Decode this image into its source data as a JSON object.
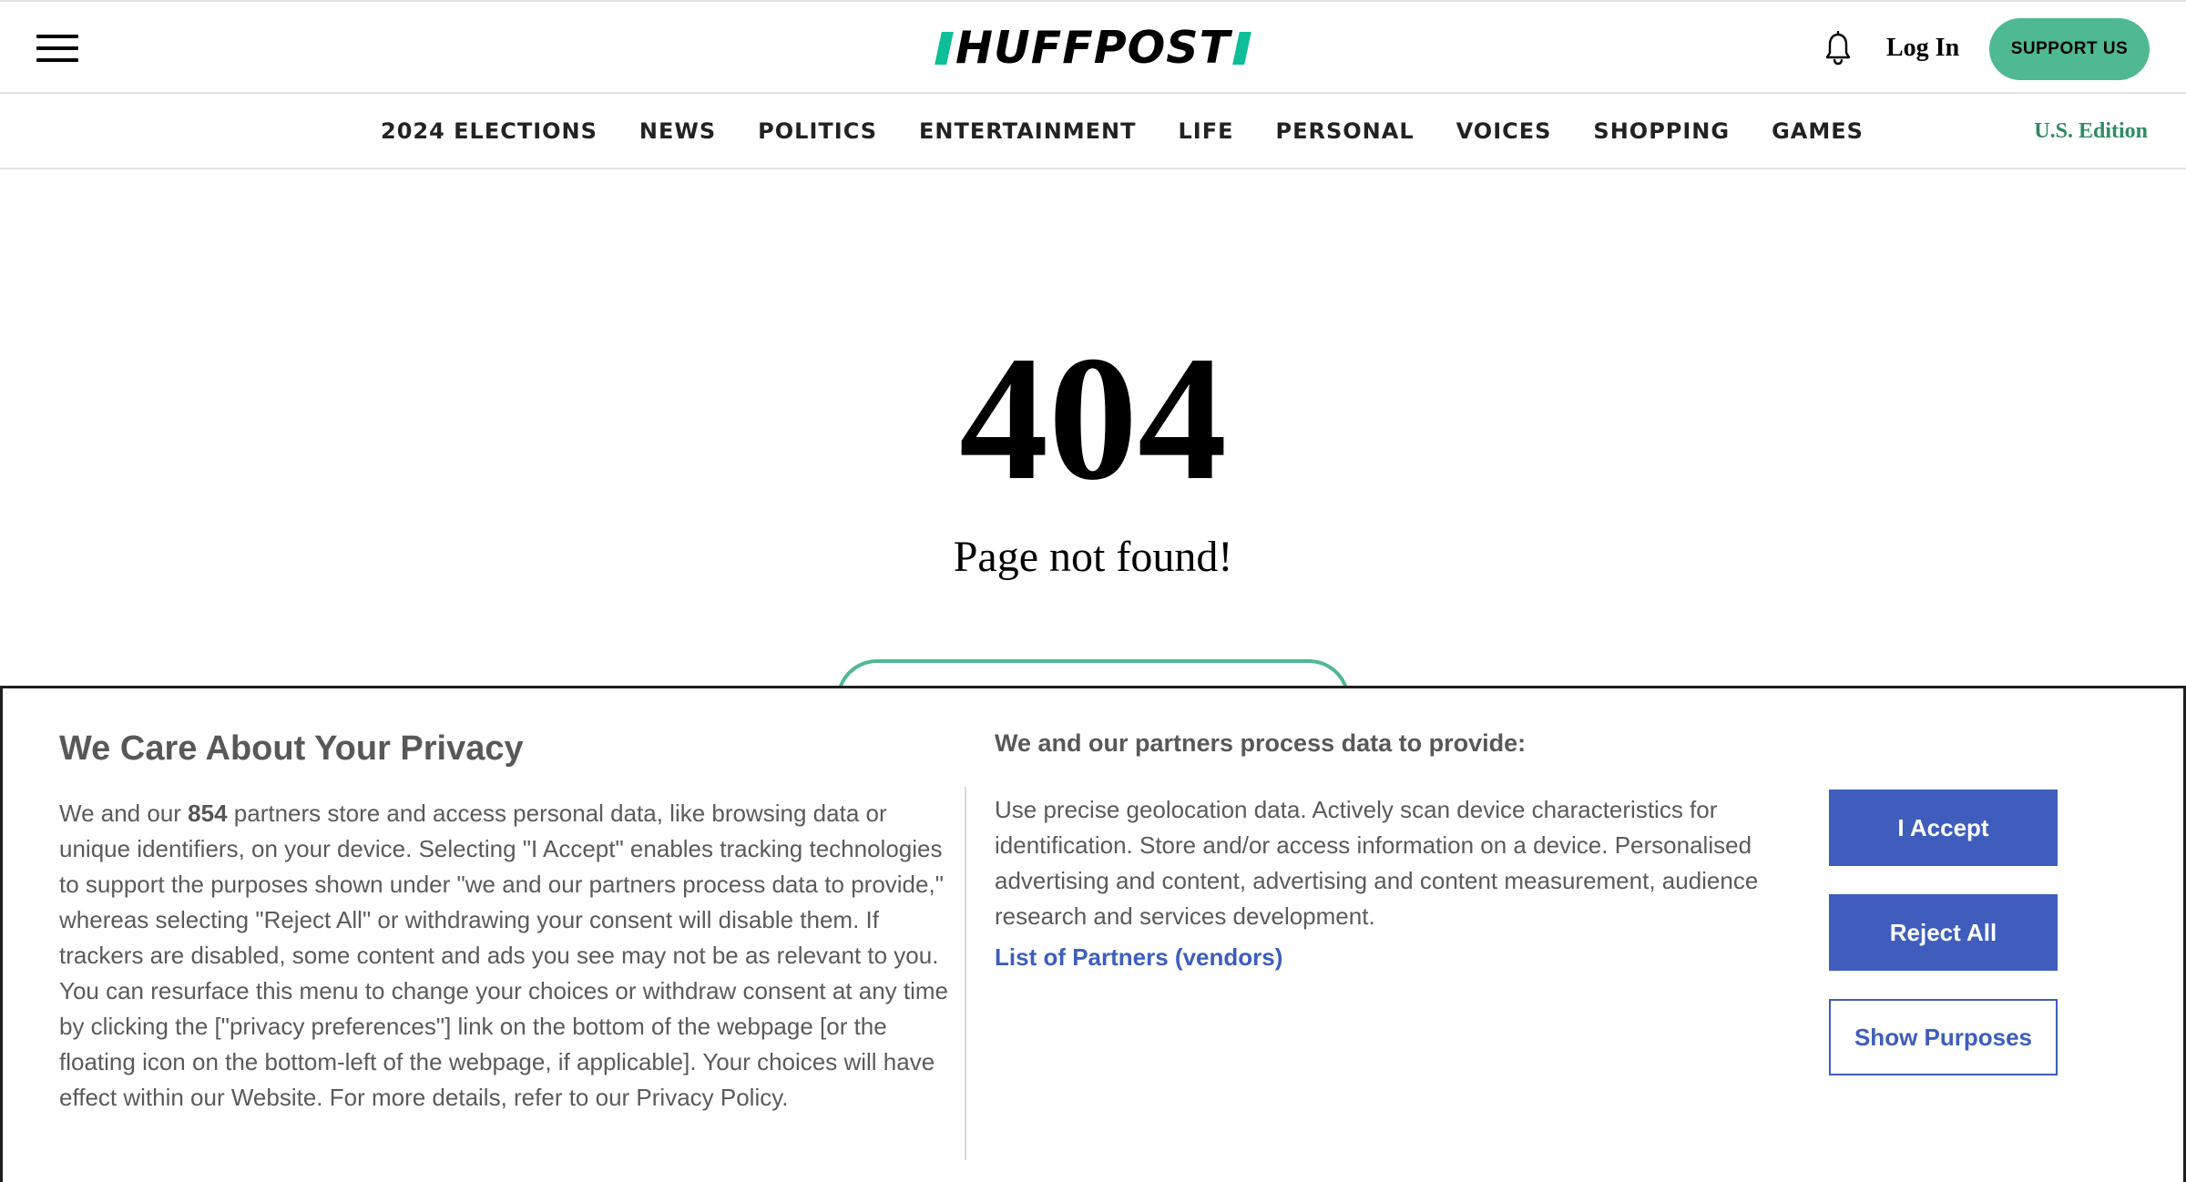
{
  "header": {
    "logo_text": "HUFFPOST",
    "login_label": "Log In",
    "support_label": "SUPPORT US"
  },
  "nav": {
    "items": [
      "2024 ELECTIONS",
      "NEWS",
      "POLITICS",
      "ENTERTAINMENT",
      "LIFE",
      "PERSONAL",
      "VOICES",
      "SHOPPING",
      "GAMES"
    ],
    "edition_label": "U.S. Edition"
  },
  "error": {
    "code": "404",
    "message": "Page not found!"
  },
  "consent": {
    "title": "We Care About Your Privacy",
    "body_prefix": "We and our ",
    "partner_count": "854",
    "body_suffix": " partners store and access personal data, like browsing data or unique identifiers, on your device. Selecting \"I Accept\" enables tracking technologies to support the purposes shown under \"we and our partners process data to provide,\" whereas selecting \"Reject All\" or withdrawing your consent will disable them. If trackers are disabled, some content and ads you see may not be as relevant to you. You can resurface this menu to change your choices or withdraw consent at any time by clicking the [\"privacy preferences\"] link on the bottom of the webpage [or the floating icon on the bottom-left of the webpage, if applicable]. Your choices will have effect within our Website. For more details, refer to our Privacy Policy.",
    "purposes_title": "We and our partners process data to provide:",
    "purposes_body": "Use precise geolocation data. Actively scan device characteristics for identification. Store and/or access information on a device. Personalised advertising and content, advertising and content measurement, audience research and services development.",
    "partners_link": "List of Partners (vendors)",
    "accept_label": "I Accept",
    "reject_label": "Reject All",
    "purposes_label": "Show Purposes"
  },
  "colors": {
    "brand_green": "#0dbe98",
    "support_green": "#4fb991",
    "edition_green": "#2e8b61",
    "consent_blue": "#3e5dbc"
  }
}
